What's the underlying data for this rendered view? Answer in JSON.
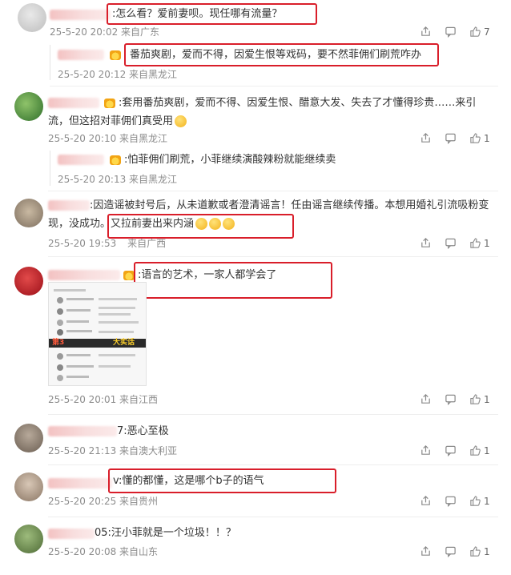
{
  "comments": [
    {
      "id": "c1",
      "text": ":怎么看？爱前妻呗。现任哪有流量？",
      "time": "25-5-20 20:02 来自广东",
      "likes": "7",
      "reply": {
        "text": "番茄爽剧，爱而不得，因爱生恨等戏码，要不然菲佣们刷荒咋办",
        "time": "25-5-20 20:12 来自黑龙江"
      }
    },
    {
      "id": "c2",
      "text_line1": ":套用番茄爽剧，爱而不得、因爱生恨、醋意大发、失去了才懂得珍贵……来引",
      "text_line2": "流，但这招对菲佣们真受用",
      "time": "25-5-20 20:10 来自黑龙江",
      "likes": "1",
      "reply": {
        "text": ":怕菲佣们刷荒，小菲继续演酸辣粉就能继续卖",
        "time": "25-5-20 20:13 来自黑龙江"
      }
    },
    {
      "id": "c3",
      "text_line1": ":因造谣被封号后，从未道歉或者澄清谣言！任由谣言继续传播。本想用婚礼引流吸粉变",
      "text_line2_a": "现，没成功。",
      "text_line2_b": "又拉前妻出来内涵",
      "time_a": "25-5-20 19:53",
      "time_b": "来自广西",
      "likes": "1"
    },
    {
      "id": "c4",
      "text": ":语言的艺术，一家人都学会了",
      "time": "25-5-20 20:01 来自江西",
      "likes": "1",
      "image_caption_a": "第3",
      "image_caption_b": "大实话"
    },
    {
      "id": "c5",
      "text": "7:恶心至极",
      "time": "25-5-20 21:13 来自澳大利亚",
      "likes": "1"
    },
    {
      "id": "c6",
      "text_a": "v:",
      "text_b": "懂的都懂，这是哪个b子的语气",
      "time": "25-5-20 20:25 来自贵州",
      "likes": "1"
    },
    {
      "id": "c7",
      "text": "05:汪小菲就是一个垃圾！！？",
      "time": "25-5-20 20:08 来自山东",
      "likes": "1"
    }
  ],
  "icons": [
    "share-icon",
    "comment-icon",
    "like-icon",
    "crown-badge-icon",
    "emoji-icon"
  ],
  "colors": {
    "highlight": "#d91e2a",
    "meta": "#8c8c8c",
    "text": "#333333"
  }
}
